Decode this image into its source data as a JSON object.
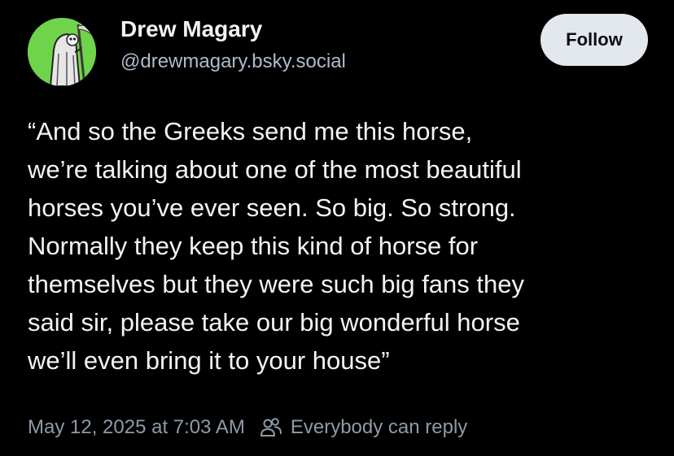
{
  "author": {
    "display_name": "Drew Magary",
    "handle": "@drewmagary.bsky.social",
    "avatar_icon": "grim-reaper-avatar",
    "avatar_bg": "#6fd44a"
  },
  "follow_button": {
    "label": "Follow"
  },
  "post": {
    "lines": [
      "“And so the Greeks send me this horse,",
      "we’re talking about one of the most beautiful",
      "horses you’ve ever seen. So big. So strong.",
      "Normally they keep this kind of horse for",
      "themselves but they were such big fans they",
      "said sir, please take our big wonderful horse",
      "we’ll even bring it to your house”"
    ]
  },
  "meta": {
    "timestamp": "May 12, 2025 at 7:03 AM",
    "reply_icon": "people-icon",
    "reply_setting": "Everybody can reply"
  },
  "colors": {
    "background": "#000000",
    "text": "#f1f3f5",
    "handle": "#aebbc9",
    "meta": "#8e9aa8",
    "follow_bg": "#e3e8ee"
  }
}
